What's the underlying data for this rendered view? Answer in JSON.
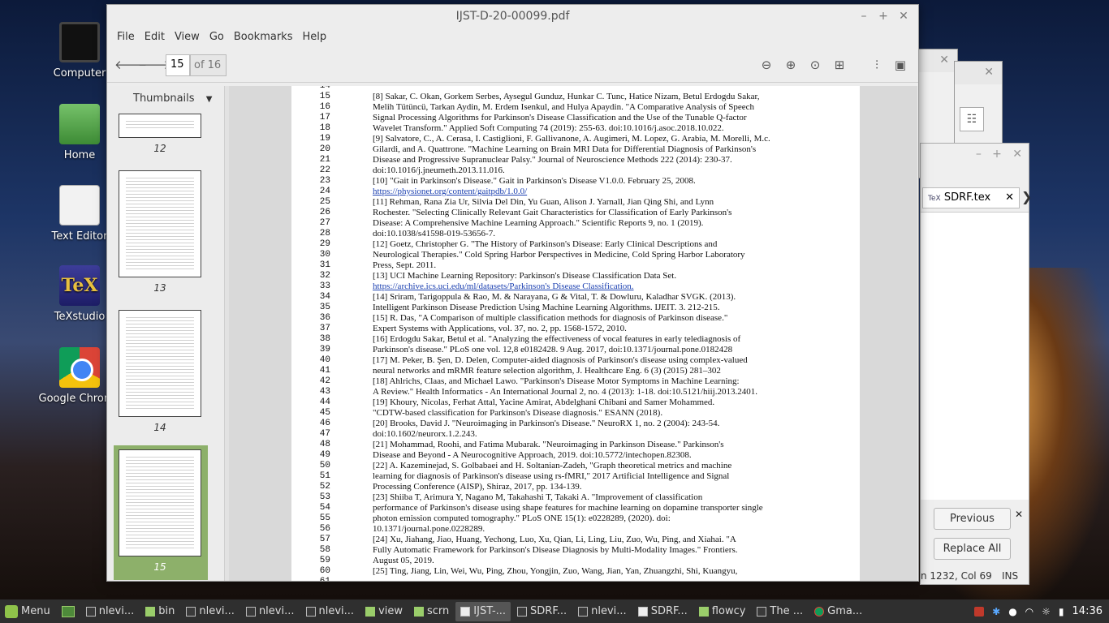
{
  "desktop": {
    "icons": [
      {
        "label": "Computer",
        "kind": "computer-icon"
      },
      {
        "label": "Home",
        "kind": "home-folder-icon"
      },
      {
        "label": "Text Editor",
        "kind": "text-editor-icon"
      },
      {
        "label": "TeXstudio",
        "kind": "texstudio-icon"
      },
      {
        "label": "Google Chrome",
        "kind": "chrome-icon"
      }
    ]
  },
  "window": {
    "title": "IJST-D-20-00099.pdf",
    "menu": [
      "File",
      "Edit",
      "View",
      "Go",
      "Bookmarks",
      "Help"
    ],
    "page_current": "15",
    "page_total": "of 16",
    "sidebar_mode": "Thumbnails",
    "thumbnails": [
      {
        "label": "12"
      },
      {
        "label": "13"
      },
      {
        "label": "14"
      },
      {
        "label": "15",
        "selected": true
      }
    ]
  },
  "document": {
    "lines": [
      {
        "n": "14",
        "t": ""
      },
      {
        "n": "15",
        "t": "[8]   Sakar, C. Okan, Gorkem Serbes, Aysegul Gunduz, Hunkar C. Tunc, Hatice Nizam, Betul Erdogdu Sakar,"
      },
      {
        "n": "16",
        "t": "Melih Tütüncü, Tarkan Aydin, M. Erdem Isenkul, and Hulya Apaydin. \"A Comparative Analysis of Speech"
      },
      {
        "n": "17",
        "t": "Signal Processing Algorithms for Parkinson's Disease Classification and the Use of the Tunable Q-factor"
      },
      {
        "n": "18",
        "t": "Wavelet Transform.\" Applied Soft Computing 74 (2019): 255-63. doi:10.1016/j.asoc.2018.10.022."
      },
      {
        "n": "19",
        "t": "[9]   Salvatore, C., A. Cerasa, I. Castiglioni, F. Gallivanone, A. Augimeri, M. Lopez, G. Arabia, M. Morelli, M.c."
      },
      {
        "n": "20",
        "t": "Gilardi, and A. Quattrone. \"Machine Learning on Brain MRI Data for Differential Diagnosis of Parkinson's"
      },
      {
        "n": "21",
        "t": "Disease and Progressive Supranuclear Palsy.\" Journal of Neuroscience Methods 222 (2014): 230-37."
      },
      {
        "n": "22",
        "t": "doi:10.1016/j.jneumeth.2013.11.016."
      },
      {
        "n": "23",
        "t": "[10]        \"Gait in Parkinson's Disease.\" Gait in Parkinson's Disease V1.0.0. February 25, 2008."
      },
      {
        "n": "24",
        "t": "https://physionet.org/content/gaitpdb/1.0.0/",
        "link": true
      },
      {
        "n": "25",
        "t": "[11]        Rehman, Rana Zia Ur, Silvia Del Din, Yu Guan, Alison J. Yarnall, Jian Qing Shi, and Lynn"
      },
      {
        "n": "26",
        "t": "Rochester. \"Selecting Clinically Relevant Gait Characteristics for Classification of Early Parkinson's"
      },
      {
        "n": "27",
        "t": "Disease: A Comprehensive Machine Learning Approach.\" Scientific Reports 9, no. 1 (2019)."
      },
      {
        "n": "28",
        "t": "doi:10.1038/s41598-019-53656-7."
      },
      {
        "n": "29",
        "t": "[12]        Goetz, Christopher G. \"The History of Parkinson's Disease: Early Clinical Descriptions and"
      },
      {
        "n": "30",
        "t": "Neurological Therapies.\" Cold Spring Harbor Perspectives in Medicine, Cold Spring Harbor Laboratory"
      },
      {
        "n": "31",
        "t": "Press, Sept. 2011."
      },
      {
        "n": "32",
        "t": "[13]        UCI Machine Learning Repository: Parkinson's Disease Classification Data Set."
      },
      {
        "n": "33",
        "t": "https://archive.ics.uci.edu/ml/datasets/Parkinson's Disease Classification.",
        "link": true
      },
      {
        "n": "34",
        "t": "[14]        Sriram, Tarigoppula & Rao, M. & Narayana, G & Vital, T. & Dowluru, Kaladhar SVGK. (2013)."
      },
      {
        "n": "35",
        "t": "Intelligent Parkinson Disease Prediction Using Machine Learning Algorithms. IJEIT. 3. 212-215."
      },
      {
        "n": "36",
        "t": "[15]        R. Das, \"A Comparison of multiple classification methods for diagnosis of Parkinson disease.\""
      },
      {
        "n": "37",
        "t": "Expert Systems with Applications, vol. 37, no. 2, pp. 1568-1572, 2010."
      },
      {
        "n": "38",
        "t": "[16]        Erdogdu Sakar, Betul et al. \"Analyzing the effectiveness of vocal features in early telediagnosis of"
      },
      {
        "n": "39",
        "t": "Parkinson's disease.\" PLoS one vol. 12,8 e0182428. 9 Aug. 2017, doi:10.1371/journal.pone.0182428"
      },
      {
        "n": "40",
        "t": "[17]        M. Peker, B. Şen, D. Delen, Computer-aided diagnosis of Parkinson's disease using complex-valued"
      },
      {
        "n": "41",
        "t": "neural networks and mRMR feature selection algorithm, J. Healthcare Eng. 6 (3) (2015) 281–302"
      },
      {
        "n": "42",
        "t": "[18]        Ahlrichs, Claas, and Michael Lawo. \"Parkinson's Disease Motor Symptoms in Machine Learning:"
      },
      {
        "n": "43",
        "t": "A Review.\" Health Informatics - An International Journal 2, no. 4 (2013): 1-18. doi:10.5121/hiij.2013.2401."
      },
      {
        "n": "44",
        "t": "[19]        Khoury, Nicolas, Ferhat Attal, Yacine Amirat, Abdelghani Chibani and Samer Mohammed."
      },
      {
        "n": "45",
        "t": "\"CDTW-based classification for Parkinson's Disease diagnosis.\" ESANN (2018)."
      },
      {
        "n": "46",
        "t": "[20]        Brooks, David J. \"Neuroimaging in Parkinson's Disease.\" NeuroRX 1, no. 2 (2004): 243-54."
      },
      {
        "n": "47",
        "t": "doi:10.1602/neurorx.1.2.243."
      },
      {
        "n": "48",
        "t": "[21]        Mohammad, Roohi, and Fatima Mubarak. \"Neuroimaging in Parkinson Disease.\" Parkinson's"
      },
      {
        "n": "49",
        "t": "Disease and Beyond - A Neurocognitive Approach, 2019. doi:10.5772/intechopen.82308."
      },
      {
        "n": "50",
        "t": "[22]        A. Kazeminejad, S. Golbabaei and H. Soltanian-Zadeh, \"Graph theoretical metrics and machine"
      },
      {
        "n": "51",
        "t": "learning for diagnosis of Parkinson's disease using rs-fMRI,\" 2017 Artificial Intelligence and Signal"
      },
      {
        "n": "52",
        "t": "Processing Conference (AISP), Shiraz, 2017, pp. 134-139."
      },
      {
        "n": "53",
        "t": "[23]        Shiiba T, Arimura Y, Nagano M, Takahashi T, Takaki A. \"Improvement of classification"
      },
      {
        "n": "54",
        "t": "performance of Parkinson's disease using shape features for machine learning on dopamine transporter single"
      },
      {
        "n": "55",
        "t": "photon emission computed tomography.\" PLoS ONE 15(1): e0228289, (2020). doi:"
      },
      {
        "n": "56",
        "t": "10.1371/journal.pone.0228289."
      },
      {
        "n": "57",
        "t": "[24]        Xu, Jiahang, Jiao, Huang, Yechong, Luo, Xu, Qian, Li, Ling, Liu, Zuo, Wu, Ping, and Xiahai. \"A"
      },
      {
        "n": "58",
        "t": "Fully Automatic Framework for Parkinson's Disease Diagnosis by Multi-Modality Images.\" Frontiers."
      },
      {
        "n": "59",
        "t": "August 05, 2019."
      },
      {
        "n": "60",
        "t": "[25]        Ting, Jiang, Lin, Wei, Wu, Ping, Zhou, Yongjin, Zuo, Wang, Jian, Yan, Zhuangzhi, Shi, Kuangyu,"
      },
      {
        "n": "61",
        "t": ""
      }
    ]
  },
  "texstudio": {
    "tab_label": "SDRF.tex",
    "previous_label": "Previous",
    "replace_all_label": "Replace All",
    "status": "n 1232, Col 69",
    "mode": "INS"
  },
  "taskbar": {
    "menu_label": "Menu",
    "tasks": [
      {
        "label": "nlevi...",
        "icon": "terminal-icon"
      },
      {
        "label": "bin",
        "icon": "folder-icon"
      },
      {
        "label": "nlevi...",
        "icon": "terminal-icon"
      },
      {
        "label": "nlevi...",
        "icon": "terminal-icon"
      },
      {
        "label": "nlevi...",
        "icon": "terminal-icon"
      },
      {
        "label": "view",
        "icon": "folder-icon"
      },
      {
        "label": "scrn",
        "icon": "folder-icon"
      },
      {
        "label": "IJST-...",
        "icon": "pdf-icon",
        "active": true
      },
      {
        "label": "SDRF...",
        "icon": "editor-icon"
      },
      {
        "label": "nlevi...",
        "icon": "terminal-icon"
      },
      {
        "label": "SDRF...",
        "icon": "document-icon"
      },
      {
        "label": "flowcy",
        "icon": "folder-icon"
      },
      {
        "label": "The ...",
        "icon": "film-icon"
      },
      {
        "label": "Gma...",
        "icon": "chrome-icon"
      }
    ],
    "clock": "14:36"
  }
}
